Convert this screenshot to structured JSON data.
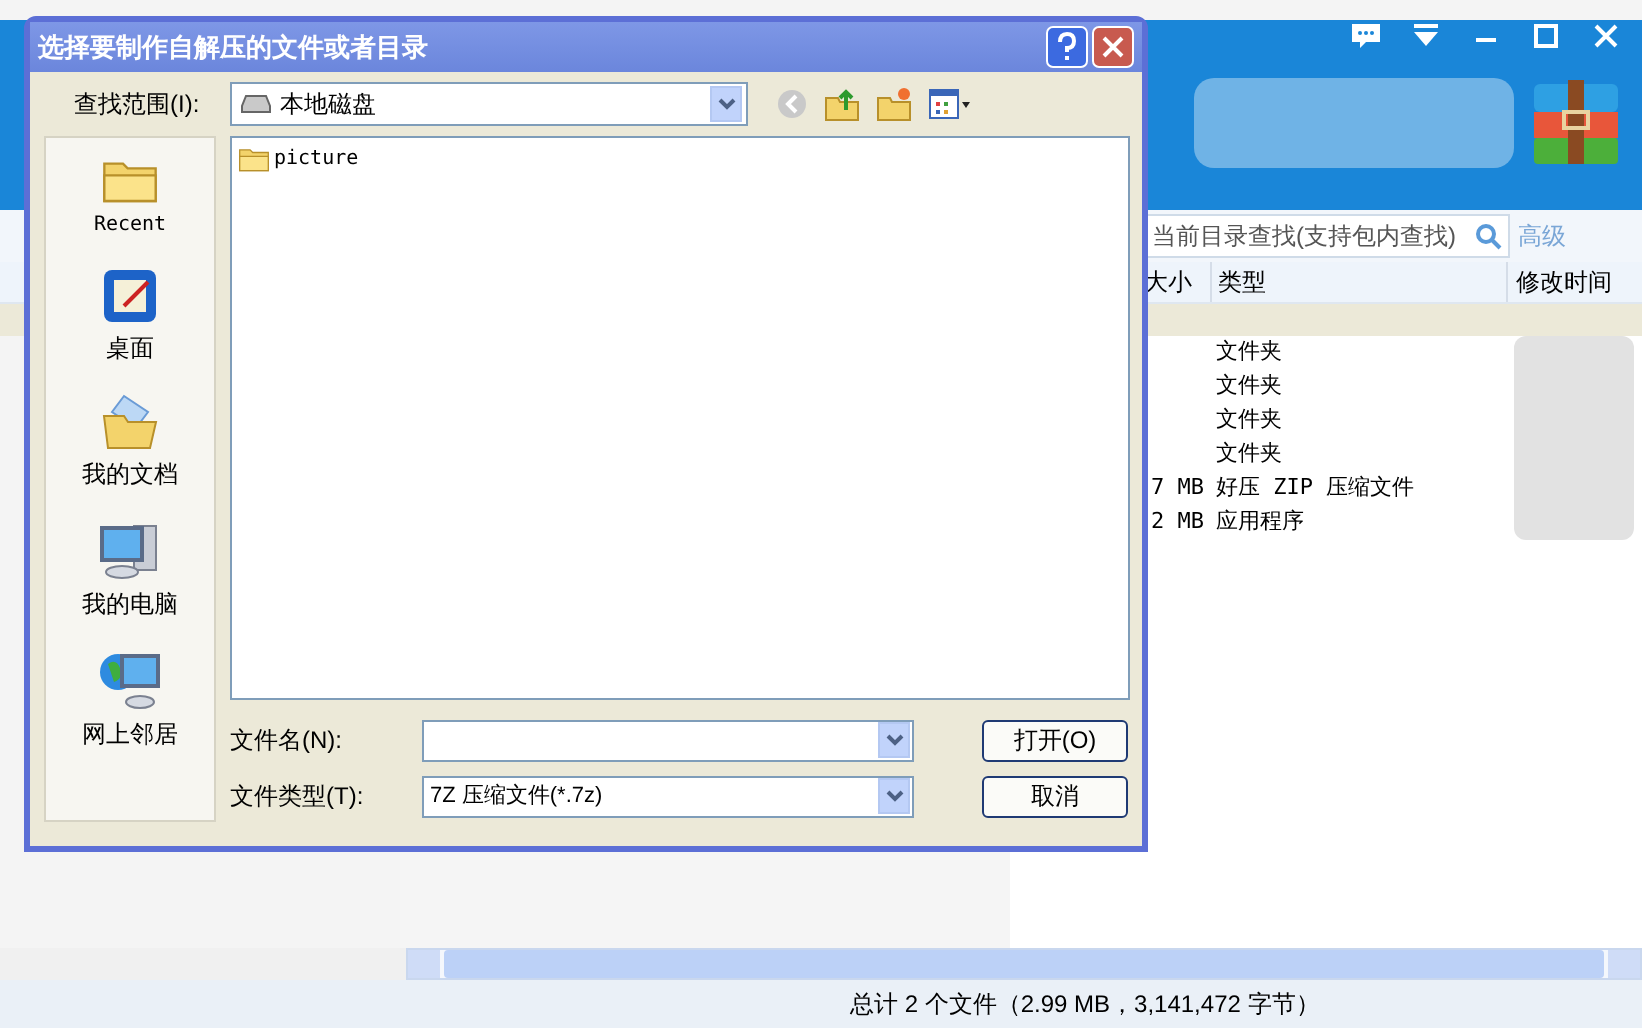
{
  "app": {
    "window_buttons": [
      {
        "kind": "feedback"
      },
      {
        "kind": "menu"
      },
      {
        "kind": "minimize"
      },
      {
        "kind": "maximize"
      },
      {
        "kind": "close"
      }
    ],
    "search": {
      "placeholder": "当前目录查找(支持包内查找)"
    },
    "advanced_link": "高级",
    "columns": [
      "大小",
      "类型",
      "修改时间"
    ],
    "rows": [
      {
        "type": "文件夹"
      },
      {
        "type": "文件夹"
      },
      {
        "type": "文件夹"
      },
      {
        "type": "文件夹"
      },
      {
        "size": "7 MB",
        "type": "好压 ZIP 压缩文件"
      },
      {
        "size": "2 MB",
        "type": "应用程序"
      }
    ],
    "status": "总计 2 个文件（2.99 MB，3,141,472 字节）"
  },
  "dialog": {
    "title": "选择要制作自解压的文件或者目录",
    "look_in_label": "查找范围(I):",
    "look_in_value": "本地磁盘",
    "places": [
      {
        "kind": "recent",
        "label": "Recent"
      },
      {
        "kind": "desktop",
        "label": "桌面"
      },
      {
        "kind": "documents",
        "label": "我的文档"
      },
      {
        "kind": "computer",
        "label": "我的电脑"
      },
      {
        "kind": "network",
        "label": "网上邻居"
      }
    ],
    "files": [
      {
        "name": "picture"
      }
    ],
    "filename_label": "文件名(N):",
    "filetype_label": "文件类型(T):",
    "filetype_value": "7Z 压缩文件(*.7z)",
    "buttons": [
      "打开(O)",
      "取消"
    ]
  }
}
